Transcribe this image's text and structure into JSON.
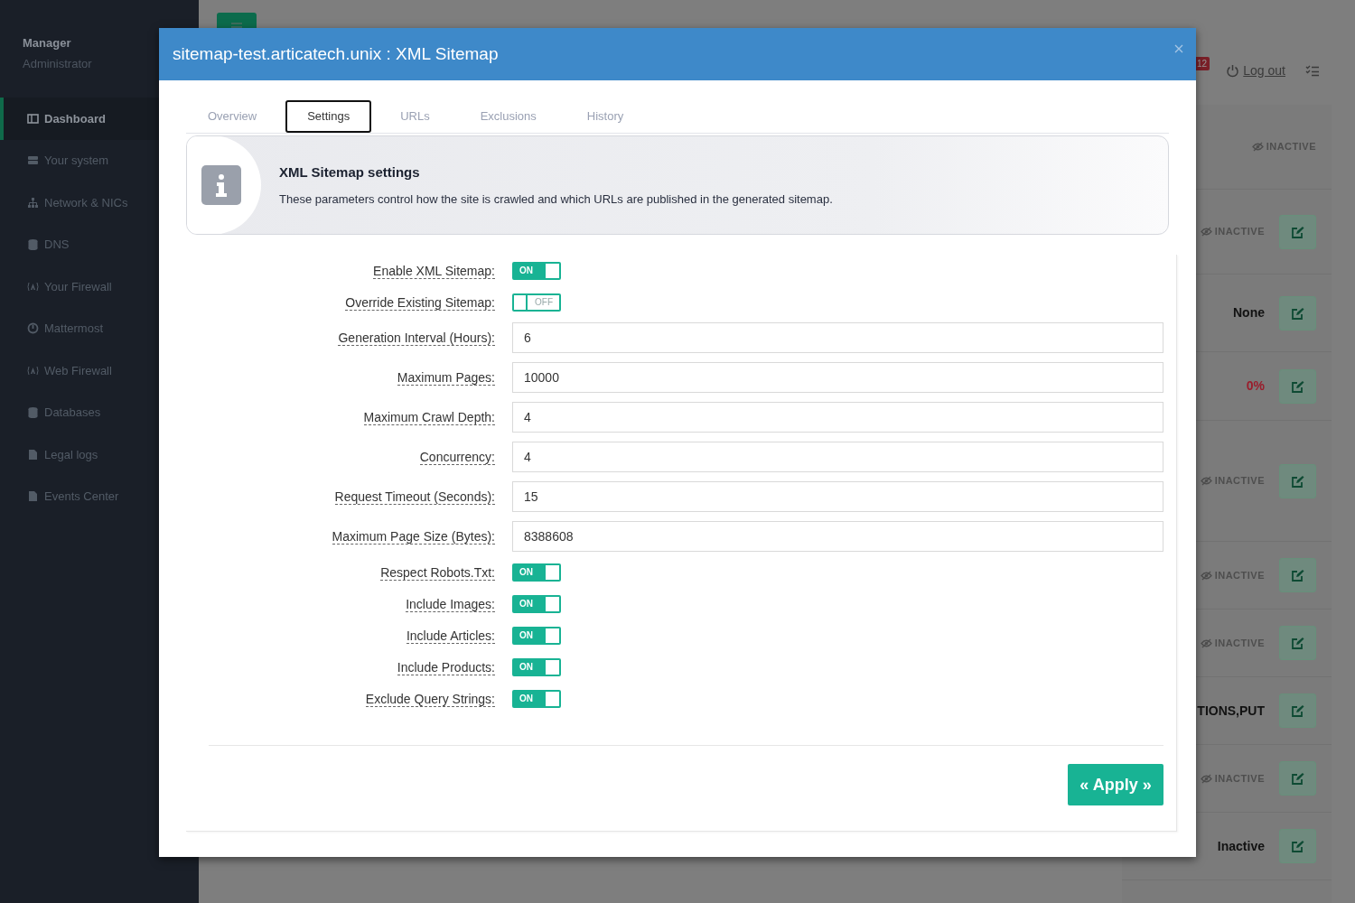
{
  "sidebar": {
    "user": {
      "name": "Manager",
      "role": "Administrator"
    },
    "items": [
      {
        "label": "Dashboard",
        "selected": true
      },
      {
        "label": "Your system",
        "selected": false
      },
      {
        "label": "Network & NICs",
        "selected": false
      },
      {
        "label": "DNS",
        "selected": false
      },
      {
        "label": "Your Firewall",
        "selected": false
      },
      {
        "label": "Mattermost",
        "selected": false
      },
      {
        "label": "Web Firewall",
        "selected": false
      },
      {
        "label": "Databases",
        "selected": false
      },
      {
        "label": "Legal logs",
        "selected": false
      },
      {
        "label": "Events Center",
        "selected": false
      }
    ]
  },
  "topbar": {
    "notification_count": "12",
    "logout": "Log out"
  },
  "background_rows": [
    {
      "kind": "status",
      "text": "INACTIVE",
      "edit_button": false
    },
    {
      "kind": "status",
      "text": "INACTIVE",
      "edit_button": true
    },
    {
      "kind": "value",
      "text": "None",
      "edit_button": true
    },
    {
      "kind": "percent",
      "text": "0%",
      "edit_button": true
    },
    {
      "kind": "status",
      "text": "INACTIVE",
      "edit_button": true
    },
    {
      "kind": "status",
      "text": "INACTIVE",
      "edit_button": true
    },
    {
      "kind": "status",
      "text": "INACTIVE",
      "edit_button": true
    },
    {
      "kind": "value",
      "text": "TIONS,PUT",
      "edit_button": true
    },
    {
      "kind": "status",
      "text": "INACTIVE",
      "edit_button": true
    },
    {
      "kind": "value",
      "text": "Inactive",
      "edit_button": true
    }
  ],
  "dialog": {
    "title": "sitemap-test.articatech.unix : XML Sitemap",
    "tabs": [
      {
        "label": "Overview",
        "selected": false
      },
      {
        "label": "Settings",
        "selected": true
      },
      {
        "label": "URLs",
        "selected": false
      },
      {
        "label": "Exclusions",
        "selected": false
      },
      {
        "label": "History",
        "selected": false
      }
    ],
    "info": {
      "title": "XML Sitemap settings",
      "text": "These parameters control how the site is crawled and which URLs are published in the generated sitemap."
    },
    "fields": [
      {
        "kind": "switch",
        "label": "Enable XML Sitemap:",
        "on": true,
        "text": "ON"
      },
      {
        "kind": "switch",
        "label": "Override Existing Sitemap:",
        "on": false,
        "text": "OFF"
      },
      {
        "kind": "input",
        "label": "Generation Interval (Hours):",
        "value": "6"
      },
      {
        "kind": "input",
        "label": "Maximum Pages:",
        "value": "10000"
      },
      {
        "kind": "input",
        "label": "Maximum Crawl Depth:",
        "value": "4"
      },
      {
        "kind": "input",
        "label": "Concurrency:",
        "value": "4"
      },
      {
        "kind": "input",
        "label": "Request Timeout (Seconds):",
        "value": "15"
      },
      {
        "kind": "input",
        "label": "Maximum Page Size (Bytes):",
        "value": "8388608"
      },
      {
        "kind": "switch",
        "label": "Respect Robots.Txt:",
        "on": true,
        "text": "ON"
      },
      {
        "kind": "switch",
        "label": "Include Images:",
        "on": true,
        "text": "ON"
      },
      {
        "kind": "switch",
        "label": "Include Articles:",
        "on": true,
        "text": "ON"
      },
      {
        "kind": "switch",
        "label": "Include Products:",
        "on": true,
        "text": "ON"
      },
      {
        "kind": "switch",
        "label": "Exclude Query Strings:",
        "on": true,
        "text": "ON"
      }
    ],
    "apply_button": "« Apply »"
  }
}
